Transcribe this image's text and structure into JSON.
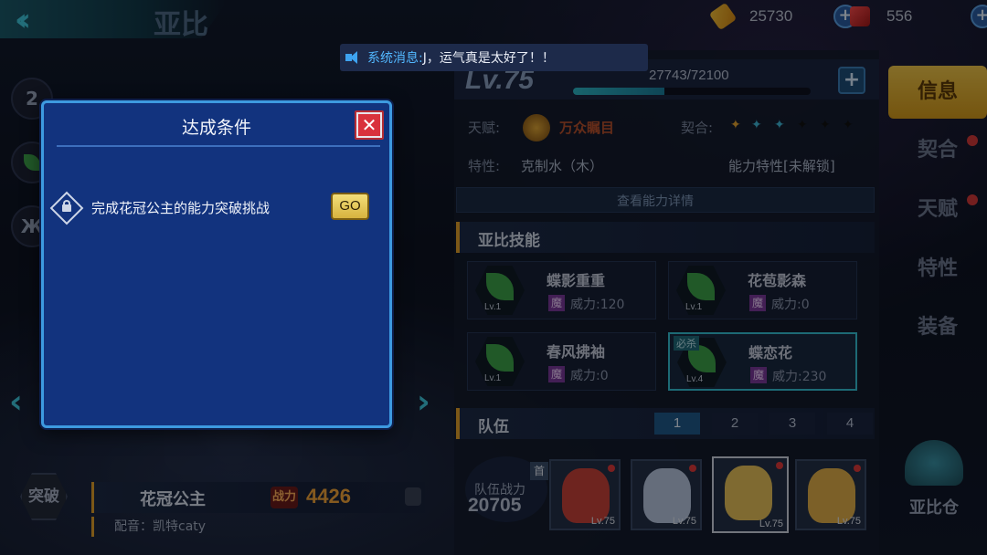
{
  "header": {
    "hero_name": "亚比",
    "tickets": "25730",
    "gems": "556"
  },
  "system_message": {
    "prefix": "系统消息:",
    "text": "J，运气真是太好了！！"
  },
  "modal": {
    "title": "达成条件",
    "condition": "完成花冠公主的能力突破挑战",
    "go_label": "GO"
  },
  "left": {
    "rank_badge": "2",
    "breakthrough_label": "突破",
    "name": "花冠公主",
    "power_tag": "战力",
    "power": "4426",
    "voice": "配音：凯特caty"
  },
  "info": {
    "level": "Lv.75",
    "xp": "27743/72100",
    "xp_fraction": 0.385,
    "talent_label": "天赋:",
    "talent_value": "万众瞩目",
    "pact_label": "契合:",
    "trait_label": "特性:",
    "trait_value": "克制水（木）",
    "ability_value": "能力特性[未解锁]",
    "detail_label": "查看能力详情"
  },
  "skills": {
    "title": "亚比技能",
    "items": [
      {
        "name": "蝶影重重",
        "tag": "魔",
        "power": "威力:120",
        "lv": "Lv.1",
        "badge": ""
      },
      {
        "name": "花苞影森",
        "tag": "魔",
        "power": "威力:0",
        "lv": "Lv.1",
        "badge": ""
      },
      {
        "name": "春风拂袖",
        "tag": "魔",
        "power": "威力:0",
        "lv": "Lv.1",
        "badge": ""
      },
      {
        "name": "蝶恋花",
        "tag": "魔",
        "power": "威力:230",
        "lv": "Lv.4",
        "badge": "必杀"
      }
    ]
  },
  "team": {
    "title": "队伍",
    "tabs": [
      "1",
      "2",
      "3",
      "4"
    ],
    "power_label": "队伍战力",
    "power": "20705",
    "captain_label": "首",
    "members": [
      {
        "lv": "Lv.75",
        "color": "#c9433a"
      },
      {
        "lv": "Lv.75",
        "color": "#b8c6e0"
      },
      {
        "lv": "Lv.75",
        "color": "#e8c25a"
      },
      {
        "lv": "Lv.75",
        "color": "#e2b04a"
      }
    ]
  },
  "side_tabs": [
    "信息",
    "契合",
    "天赋",
    "特性",
    "装备"
  ],
  "warehouse_label": "亚比仓"
}
